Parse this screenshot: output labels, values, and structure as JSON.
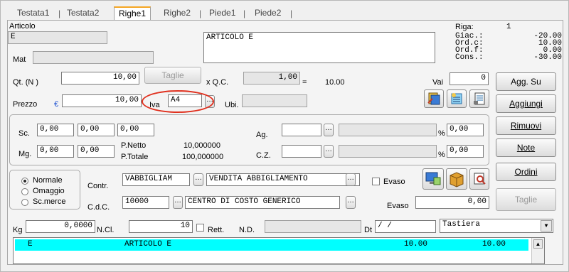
{
  "tabs": [
    {
      "label": "Testata1"
    },
    {
      "label": "Testata2"
    },
    {
      "label": "Righe1"
    },
    {
      "label": "Righe2"
    },
    {
      "label": "Piede1"
    },
    {
      "label": "Piede2"
    }
  ],
  "articolo": {
    "label": "Articolo",
    "code": "E",
    "description": "ARTICOLO E",
    "mat_label": "Mat",
    "mat_value": ""
  },
  "riga": {
    "label": "Riga:",
    "value": "1"
  },
  "stock": {
    "giac_label": "Giac.:",
    "giac": "-20.00",
    "ordc_label": "Ord.c:",
    "ordc": "10.00",
    "ordf_label": "Ord.f:",
    "ordf": "0.00",
    "cons_label": "Cons.:",
    "cons": "-30.00"
  },
  "qt": {
    "label": "Qt. (N )",
    "value": "10,00",
    "taglie_btn": "Taglie",
    "x_qc_label": "x Q.C.",
    "qc_value": "1,00",
    "eq": "=",
    "total": "10.00",
    "vai_label": "Vai",
    "vai_value": "0"
  },
  "prezzo": {
    "label": "Prezzo",
    "currency": "€",
    "value": "10,00",
    "iva_label": "Iva",
    "iva_value": "A4",
    "ubi_label": "Ubi."
  },
  "sconti": {
    "sc_label": "Sc.",
    "sc1": "0,00",
    "sc2": "0,00",
    "sc3": "0,00",
    "mg_label": "Mg.",
    "mg1": "0,00",
    "mg2": "0,00",
    "pnetto_label": "P.Netto",
    "pnetto": "10,000000",
    "ptotale_label": "P.Totale",
    "ptotale": "100,000000",
    "ag_label": "Ag.",
    "ag_value": "",
    "ag_pct": "0,00",
    "cz_label": "C.Z.",
    "cz_value": "",
    "cz_pct": "0,00",
    "pct": "%"
  },
  "tipo": {
    "normale": "Normale",
    "omaggio": "Omaggio",
    "scmerce": "Sc.merce"
  },
  "contr": {
    "label": "Contr.",
    "code": "VABBIGLIAM",
    "desc": "VENDITA ABBIGLIAMENTO"
  },
  "cdc": {
    "label": "C.d.C.",
    "code": "10000",
    "desc": "CENTRO DI COSTO GENERICO"
  },
  "evaso": {
    "check_label": "Evaso",
    "label": "Evaso",
    "value": "0,00"
  },
  "buttons": {
    "agg_su": "Agg. Su",
    "aggiungi": "Aggiungi",
    "rimuovi": "Rimuovi",
    "note": "Note",
    "ordini": "Ordini",
    "taglie": "Taglie"
  },
  "bottom": {
    "kg_label": "Kg",
    "kg_value": "0,0000",
    "ncl_label": "N.Cl.",
    "ncl_value": "10",
    "rett_label": "Rett.",
    "nd_label": "N.D.",
    "dt_label": "Dt",
    "dt_value": "/  /",
    "tastiera": "Tastiera"
  },
  "grid_rows": [
    {
      "code": "E",
      "desc": "ARTICOLO E",
      "qty": "10.00",
      "total": "10.00"
    }
  ],
  "colors": {
    "tab_accent": "#f5a623",
    "grid_highlight": "#00ffff",
    "annotation": "#e0301e",
    "currency": "#1a4fd0"
  }
}
